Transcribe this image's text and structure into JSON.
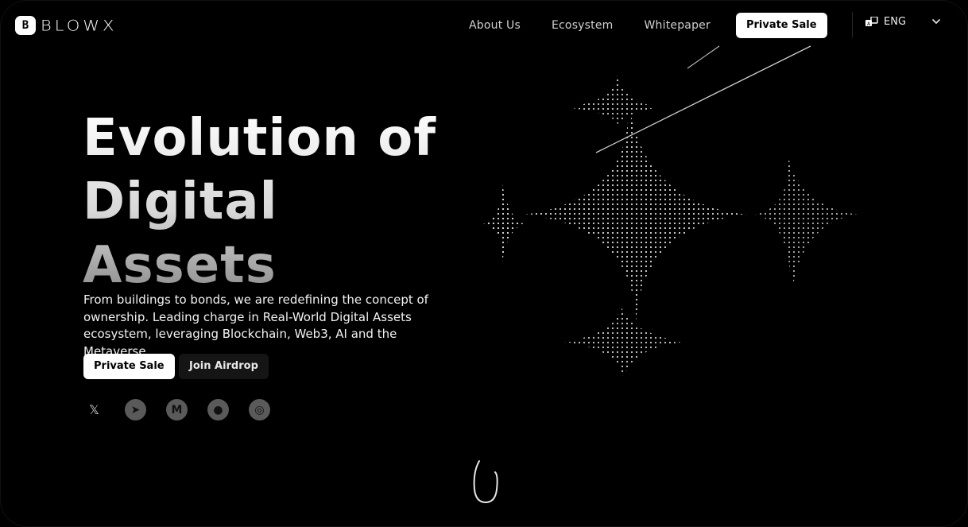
{
  "brand": {
    "logo_mark": "B",
    "logo_text": "BLOWX"
  },
  "nav": {
    "links": [
      "About Us",
      "Ecosystem",
      "Whitepaper"
    ],
    "cta": "Private Sale",
    "language": "ENG",
    "icons": {
      "language": "translate-icon",
      "dropdown": "chevron-down-icon"
    }
  },
  "hero": {
    "title_lines": [
      "Evolution of",
      "Digital",
      "Assets"
    ],
    "description": "From buildings to bonds, we are redefining the concept of ownership. Leading charge in Real-World Digital Assets ecosystem, leveraging Blockchain, Web3, AI and the Metaverse.",
    "primary_button": "Private Sale",
    "secondary_button": "Join Airdrop"
  },
  "socials": [
    {
      "name": "x-icon",
      "glyph": "𝕏"
    },
    {
      "name": "telegram-icon",
      "glyph": "➤"
    },
    {
      "name": "medium-icon",
      "glyph": "M"
    },
    {
      "name": "github-icon",
      "glyph": "●"
    },
    {
      "name": "instagram-icon",
      "glyph": "◎"
    }
  ],
  "colors": {
    "background": "#000000",
    "primary_button": "#ffffff",
    "secondary_button": "#151515"
  }
}
